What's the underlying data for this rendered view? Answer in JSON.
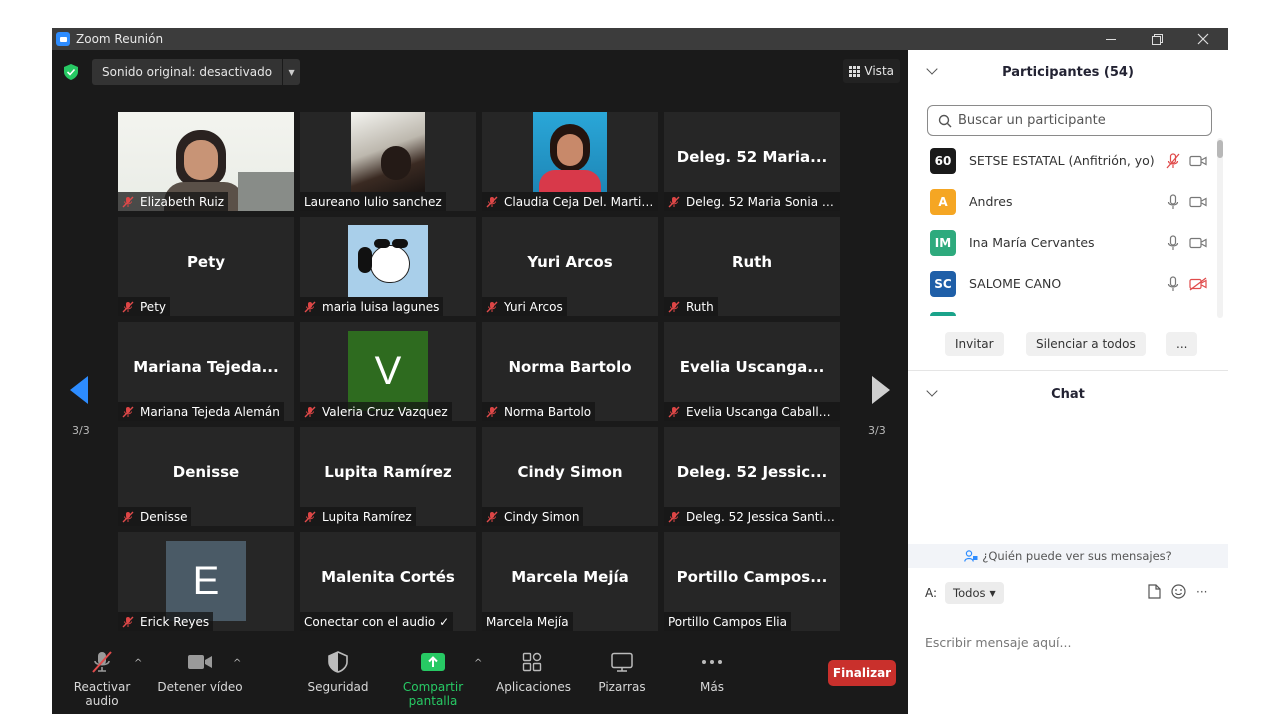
{
  "window": {
    "title": "Zoom Reunión"
  },
  "meeting": {
    "sound_label": "Sonido original: desactivado",
    "view_label": "Vista",
    "page_left": "3/3",
    "page_right": "3/3"
  },
  "tiles": [
    {
      "label": "Elizabeth Ruiz",
      "muted": true,
      "type": "video"
    },
    {
      "label": "Laureano lulio sanchez",
      "muted": false,
      "type": "photo"
    },
    {
      "label": "Claudia Ceja Del. Martin...",
      "muted": true,
      "type": "photo2"
    },
    {
      "big": "Deleg. 52  Maria...",
      "label": "Deleg. 52 Maria Sonia Fl...",
      "muted": true,
      "type": "name"
    },
    {
      "big": "Pety",
      "label": "Pety",
      "muted": true,
      "type": "name"
    },
    {
      "label": "maria luisa lagunes",
      "muted": true,
      "type": "snoopy"
    },
    {
      "big": "Yuri Arcos",
      "label": "Yuri Arcos",
      "muted": true,
      "type": "name"
    },
    {
      "big": "Ruth",
      "label": "Ruth",
      "muted": true,
      "type": "name"
    },
    {
      "big": "Mariana  Tejeda...",
      "label": "Mariana Tejeda Alemán",
      "muted": true,
      "type": "name"
    },
    {
      "letter": "V",
      "label": "Valeria Cruz Vazquez",
      "muted": true,
      "type": "letter",
      "color": "#2e6b1f"
    },
    {
      "big": "Norma Bartolo",
      "label": "Norma Bartolo",
      "muted": true,
      "type": "name"
    },
    {
      "big": "Evelia  Uscanga...",
      "label": "Evelia Uscanga Caballero",
      "muted": true,
      "type": "name"
    },
    {
      "big": "Denisse",
      "label": "Denisse",
      "muted": true,
      "type": "name"
    },
    {
      "big": "Lupita Ramírez",
      "label": "Lupita Ramírez",
      "muted": true,
      "type": "name"
    },
    {
      "big": "Cindy Simon",
      "label": "Cindy Simon",
      "muted": true,
      "type": "name"
    },
    {
      "big": "Deleg. 52  Jessic...",
      "label": "Deleg. 52 Jessica Santia...",
      "muted": true,
      "type": "name"
    },
    {
      "letter": "E",
      "label": "Erick Reyes",
      "muted": true,
      "type": "letter",
      "color": "#4a5a66"
    },
    {
      "big": "Malenita Cortés",
      "label": "Conectar con el audio ✓",
      "muted": false,
      "type": "name"
    },
    {
      "big": "Marcela Mejía",
      "label": "Marcela Mejía",
      "muted": false,
      "type": "name"
    },
    {
      "big": "Portillo  Campos...",
      "label": "Portillo Campos Elia",
      "muted": false,
      "type": "name"
    }
  ],
  "toolbar": {
    "audio": "Reactivar audio",
    "video": "Detener vídeo",
    "security": "Seguridad",
    "share": "Compartir pantalla",
    "apps": "Aplicaciones",
    "whiteboards": "Pizarras",
    "more": "Más",
    "end": "Finalizar"
  },
  "participants": {
    "title": "Participantes (54)",
    "search_placeholder": "Buscar un participante",
    "list": [
      {
        "initials": "60",
        "name": "SETSE ESTATAL (Anfitrión, yo)",
        "color": "#1a1a1a",
        "mic_muted": true,
        "cam_off": false
      },
      {
        "initials": "A",
        "name": "Andres",
        "color": "#f5a623",
        "mic_muted": false,
        "cam_off": false
      },
      {
        "initials": "IM",
        "name": "Ina María Cervantes",
        "color": "#2eaa7d",
        "mic_muted": false,
        "cam_off": false
      },
      {
        "initials": "SC",
        "name": "SALOME CANO",
        "color": "#1f5fa8",
        "mic_muted": false,
        "cam_off": true
      }
    ],
    "invite": "Invitar",
    "mute_all": "Silenciar a todos",
    "more": "..."
  },
  "chat": {
    "title": "Chat",
    "who_can_see": "¿Quién puede ver sus mensajes?",
    "to_label": "A:",
    "to_value": "Todos",
    "input_placeholder": "Escribir mensaje aquí..."
  },
  "colors": {
    "accent": "#2d8cff",
    "share_green": "#27c964",
    "end_red": "#c9302c",
    "mute_red": "#e04b4b"
  }
}
